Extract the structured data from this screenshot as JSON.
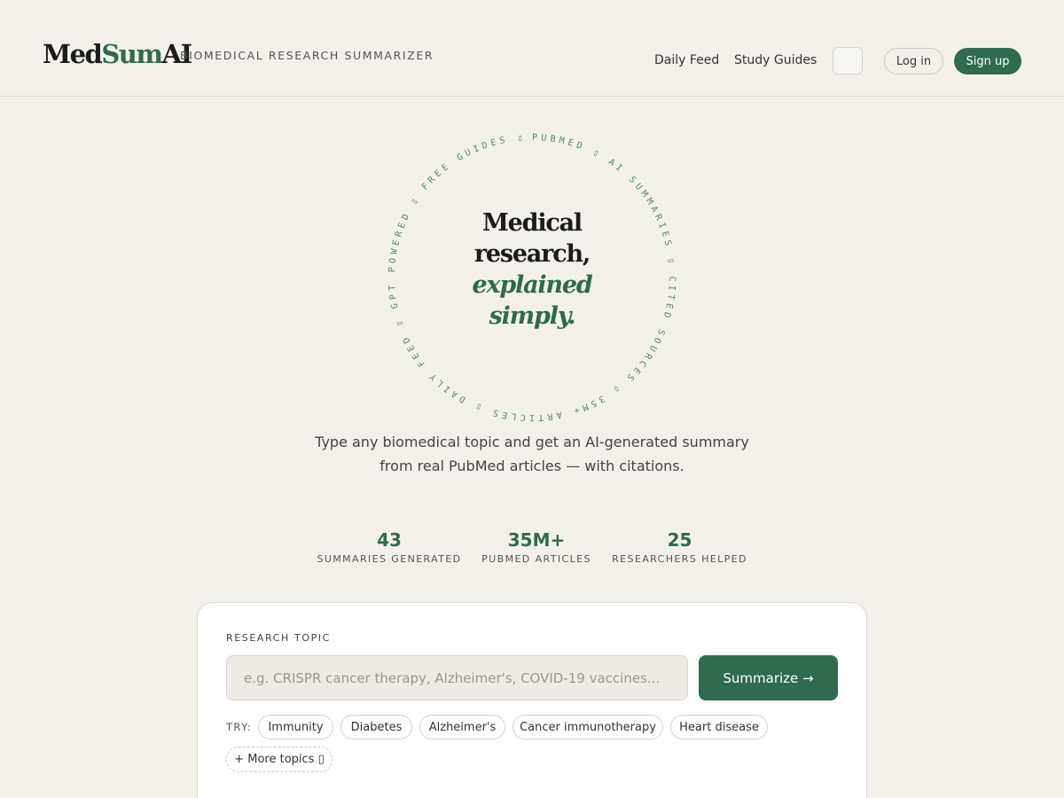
{
  "header": {
    "logo_part1": "Med",
    "logo_part2": "Sum",
    "logo_part3": "AI",
    "tagline": "BIOMEDICAL RESEARCH SUMMARIZER",
    "nav": {
      "daily_feed": "Daily Feed",
      "study_guides": "Study Guides"
    },
    "login_label": "Log in",
    "signup_label": "Sign up"
  },
  "hero": {
    "ring_text": "PUBMED ▯ AI SUMMARIES ▯ CITED SOURCES ▯ 35M+ ARTICLES ▯ DAILY FEED ▯ GPT POWERED ▯ FREE GUIDES ▯",
    "title_line1": "Medical",
    "title_line2": "research,",
    "title_line3": "explained",
    "title_line4": "simply.",
    "subtitle_line1": "Type any biomedical topic and get an AI-generated summary",
    "subtitle_line2": "from real PubMed articles — with citations."
  },
  "stats": [
    {
      "value": "43",
      "label": "SUMMARIES GENERATED"
    },
    {
      "value": "35M+",
      "label": "PUBMED ARTICLES"
    },
    {
      "value": "25",
      "label": "RESEARCHERS HELPED"
    }
  ],
  "search": {
    "label": "RESEARCH TOPIC",
    "placeholder": "e.g. CRISPR cancer therapy, Alzheimer's, COVID-19 vaccines...",
    "value": "",
    "button_label": "Summarize →",
    "try_label": "TRY:",
    "chips": [
      "Immunity",
      "Diabetes",
      "Alzheimer's",
      "Cancer immunotherapy",
      "Heart disease"
    ],
    "more_label": "+ More topics ▯"
  },
  "colors": {
    "background": "#f4f1eb",
    "accent": "#2e6b4f",
    "card": "#ffffff"
  }
}
